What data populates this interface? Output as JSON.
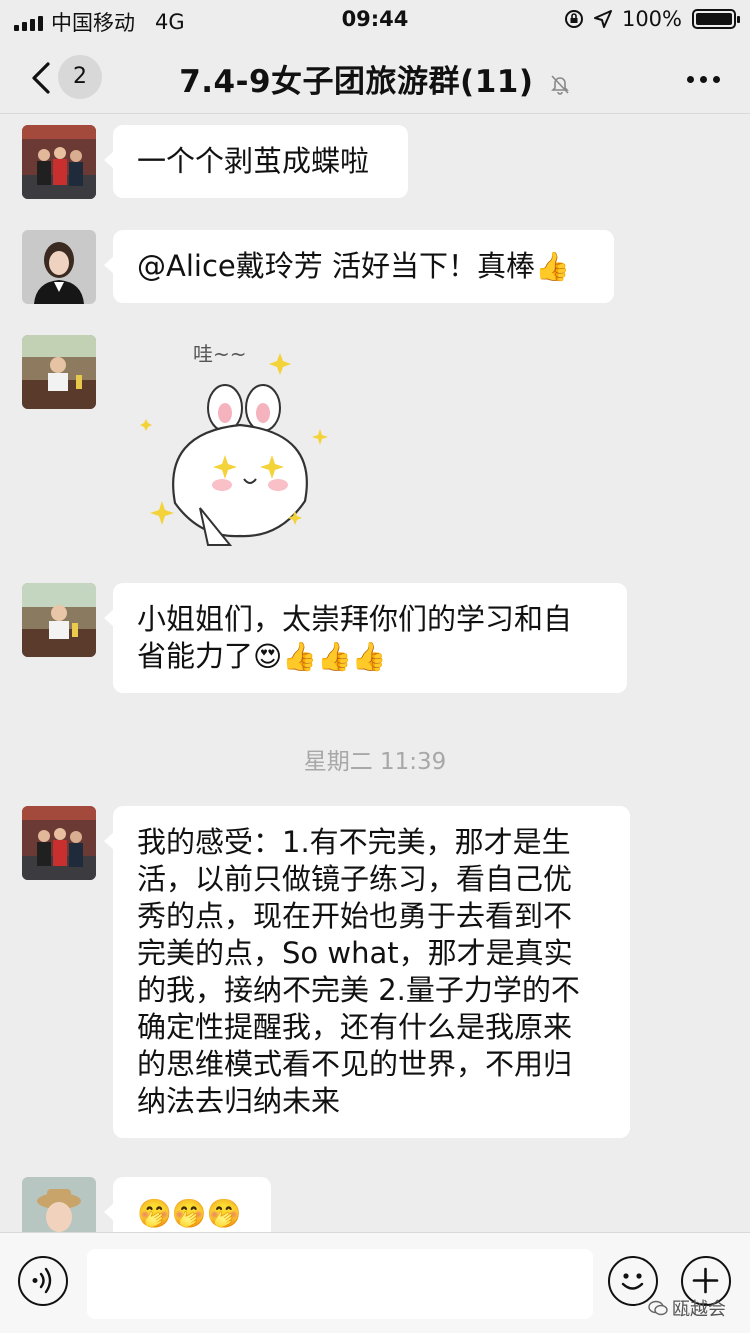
{
  "status_bar": {
    "carrier": "中国移动",
    "network": "4G",
    "time": "09:44",
    "battery": "100%",
    "battery_level": 1.0
  },
  "nav": {
    "back_badge": "2",
    "title": "7.4-9女子团旅游群(11)",
    "icons": [
      "back-chevron-icon",
      "mute-bell-icon",
      "more-dots-icon"
    ]
  },
  "messages": [
    {
      "text": "一个个剥茧成蝶啦"
    },
    {
      "text": "@Alice戴玲芳 活好当下！真棒",
      "emoji": "👍"
    },
    {
      "sticker_caption": "哇~~",
      "sticker": "bunny-sticker"
    },
    {
      "line1": "小姐姐们，太崇拜你们的学习和自",
      "line2": "省能力了",
      "emoji": "😍👍👍👍"
    },
    {
      "lines": [
        "我的感受：1.有不完美，那才是生",
        "活，以前只做镜子练习，看自己优",
        "秀的点，现在开始也勇于去看到不",
        "完美的点，So what，那才是真实",
        "的我，接纳不完美 2.量子力学的不",
        "确定性提醒我，还有什么是我原来",
        "的思维模式看不见的世界，不用归",
        "纳法去归纳未来"
      ]
    },
    {
      "emoji": "🤭🤭🤭"
    }
  ],
  "timestamp": "星期二 11:39",
  "watermark": "瓯越会",
  "input_bar": {
    "icons": [
      "voice-icon",
      "emoji-icon",
      "plus-icon"
    ]
  },
  "colors": {
    "background": "#ededed",
    "bubble": "#ffffff",
    "timestamp": "#a8a8a8"
  }
}
